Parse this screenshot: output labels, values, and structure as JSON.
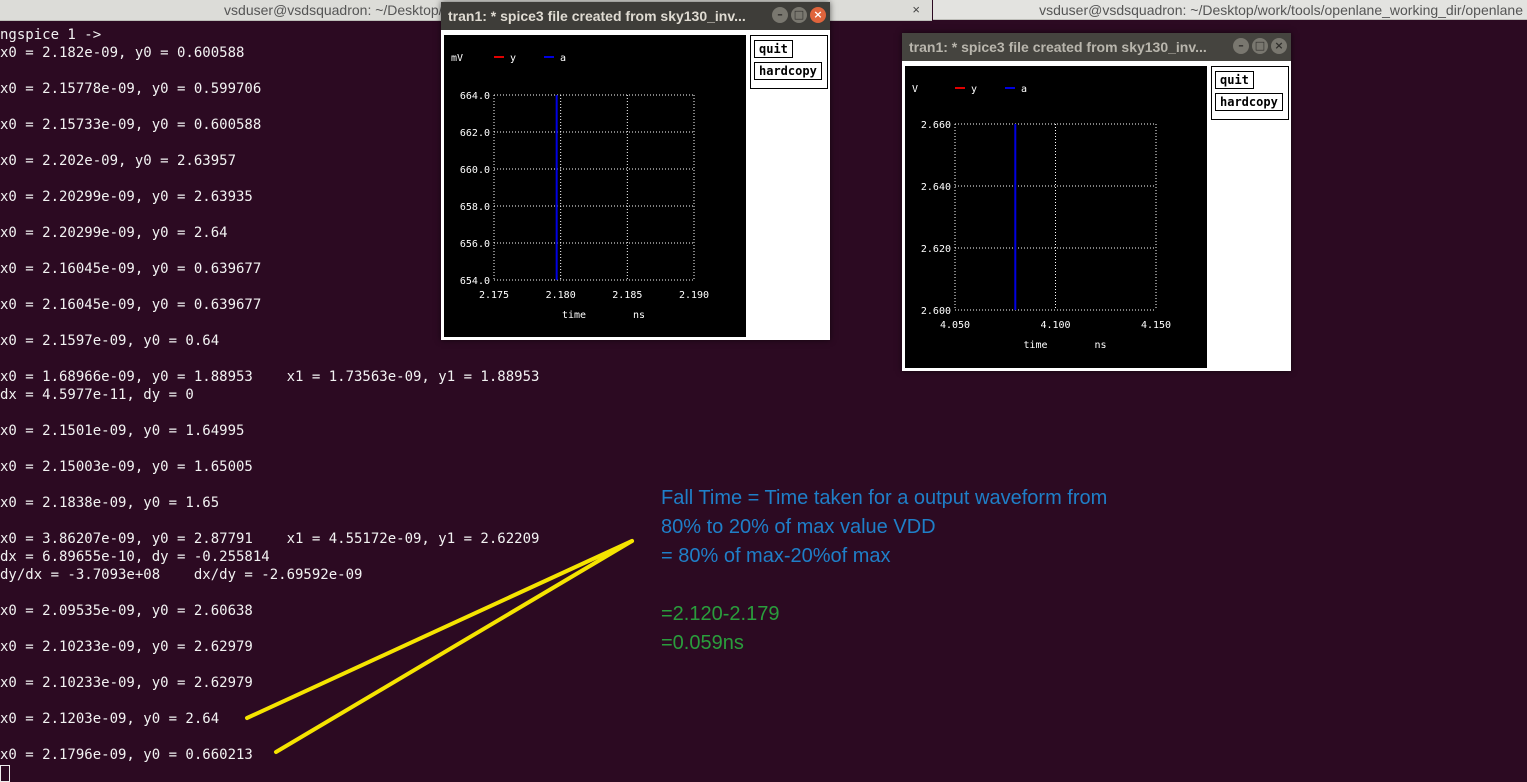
{
  "terminal_titles": {
    "left": "vsduser@vsdsquadron: ~/Desktop/work/tools/openlane_working_dir/openlane",
    "right": "vsduser@vsdsquadron: ~/Desktop/work/tools/openlane_working_dir/openlane",
    "close_glyph": "×"
  },
  "terminal": {
    "lines": [
      "ngspice 1 ->",
      "x0 = 2.182e-09, y0 = 0.600588",
      "",
      "x0 = 2.15778e-09, y0 = 0.599706",
      "",
      "x0 = 2.15733e-09, y0 = 0.600588",
      "",
      "x0 = 2.202e-09, y0 = 2.63957",
      "",
      "x0 = 2.20299e-09, y0 = 2.63935",
      "",
      "x0 = 2.20299e-09, y0 = 2.64",
      "",
      "x0 = 2.16045e-09, y0 = 0.639677",
      "",
      "x0 = 2.16045e-09, y0 = 0.639677",
      "",
      "x0 = 2.1597e-09, y0 = 0.64",
      "",
      "x0 = 1.68966e-09, y0 = 1.88953    x1 = 1.73563e-09, y1 = 1.88953",
      "dx = 4.5977e-11, dy = 0",
      "",
      "x0 = 2.1501e-09, y0 = 1.64995",
      "",
      "x0 = 2.15003e-09, y0 = 1.65005",
      "",
      "x0 = 2.1838e-09, y0 = 1.65",
      "",
      "x0 = 3.86207e-09, y0 = 2.87791    x1 = 4.55172e-09, y1 = 2.62209",
      "dx = 6.89655e-10, dy = -0.255814",
      "dy/dx = -3.7093e+08    dx/dy = -2.69592e-09",
      "",
      "x0 = 2.09535e-09, y0 = 2.60638",
      "",
      "x0 = 2.10233e-09, y0 = 2.62979",
      "",
      "x0 = 2.10233e-09, y0 = 2.62979",
      "",
      "x0 = 2.1203e-09, y0 = 2.64",
      "",
      "x0 = 2.1796e-09, y0 = 0.660213"
    ]
  },
  "plot_windows": [
    {
      "title": "tran1: * spice3 file created from sky130_inv...",
      "buttons": {
        "quit": "quit",
        "hardcopy": "hardcopy"
      },
      "window_controls": {
        "minimize": "–",
        "maximize": "□",
        "close": "×"
      }
    },
    {
      "title": "tran1: * spice3 file created from sky130_inv...",
      "buttons": {
        "quit": "quit",
        "hardcopy": "hardcopy"
      },
      "window_controls": {
        "minimize": "–",
        "maximize": "□",
        "close": "×"
      }
    }
  ],
  "chart_data": [
    {
      "type": "line",
      "ylabel_unit": "mV",
      "xlabel": "time",
      "xlabel_unit": "ns",
      "legend": [
        "y",
        "a"
      ],
      "legend_position": "top-left",
      "grid": true,
      "xlim": [
        2.175,
        2.19
      ],
      "ylim": [
        654.0,
        664.0
      ],
      "x_ticks": [
        "2.175",
        "2.180",
        "2.185",
        "2.190"
      ],
      "y_ticks": [
        "654.0",
        "656.0",
        "658.0",
        "660.0",
        "662.0",
        "664.0"
      ],
      "series": [
        {
          "name": "y",
          "color": "#e00000",
          "x": [],
          "y": []
        },
        {
          "name": "a",
          "color": "#0000e0",
          "x": [
            2.1797,
            2.1797
          ],
          "y": [
            664.0,
            654.0
          ]
        }
      ]
    },
    {
      "type": "line",
      "ylabel_unit": "V",
      "xlabel": "time",
      "xlabel_unit": "ns",
      "legend": [
        "y",
        "a"
      ],
      "legend_position": "top-left",
      "grid": true,
      "xlim": [
        4.05,
        4.15
      ],
      "ylim": [
        2.6,
        2.66
      ],
      "x_ticks": [
        "4.050",
        "4.100",
        "4.150"
      ],
      "y_ticks": [
        "2.600",
        "2.620",
        "2.640",
        "2.660"
      ],
      "series": [
        {
          "name": "y",
          "color": "#e00000",
          "x": [],
          "y": []
        },
        {
          "name": "a",
          "color": "#0000e0",
          "x": [
            4.08,
            4.08
          ],
          "y": [
            2.66,
            2.6
          ]
        }
      ]
    }
  ],
  "annotation": {
    "line1": "Fall Time = Time taken for a output waveform from",
    "line2": "80%  to 20% of max value VDD",
    "line3": "= 80% of max-20%of max",
    "line4": "=2.120-2.179",
    "line5": "=0.059ns",
    "arrow_color": "#f5e400",
    "text_blue": "#1f7fc8",
    "text_green": "#2a9d3c"
  }
}
